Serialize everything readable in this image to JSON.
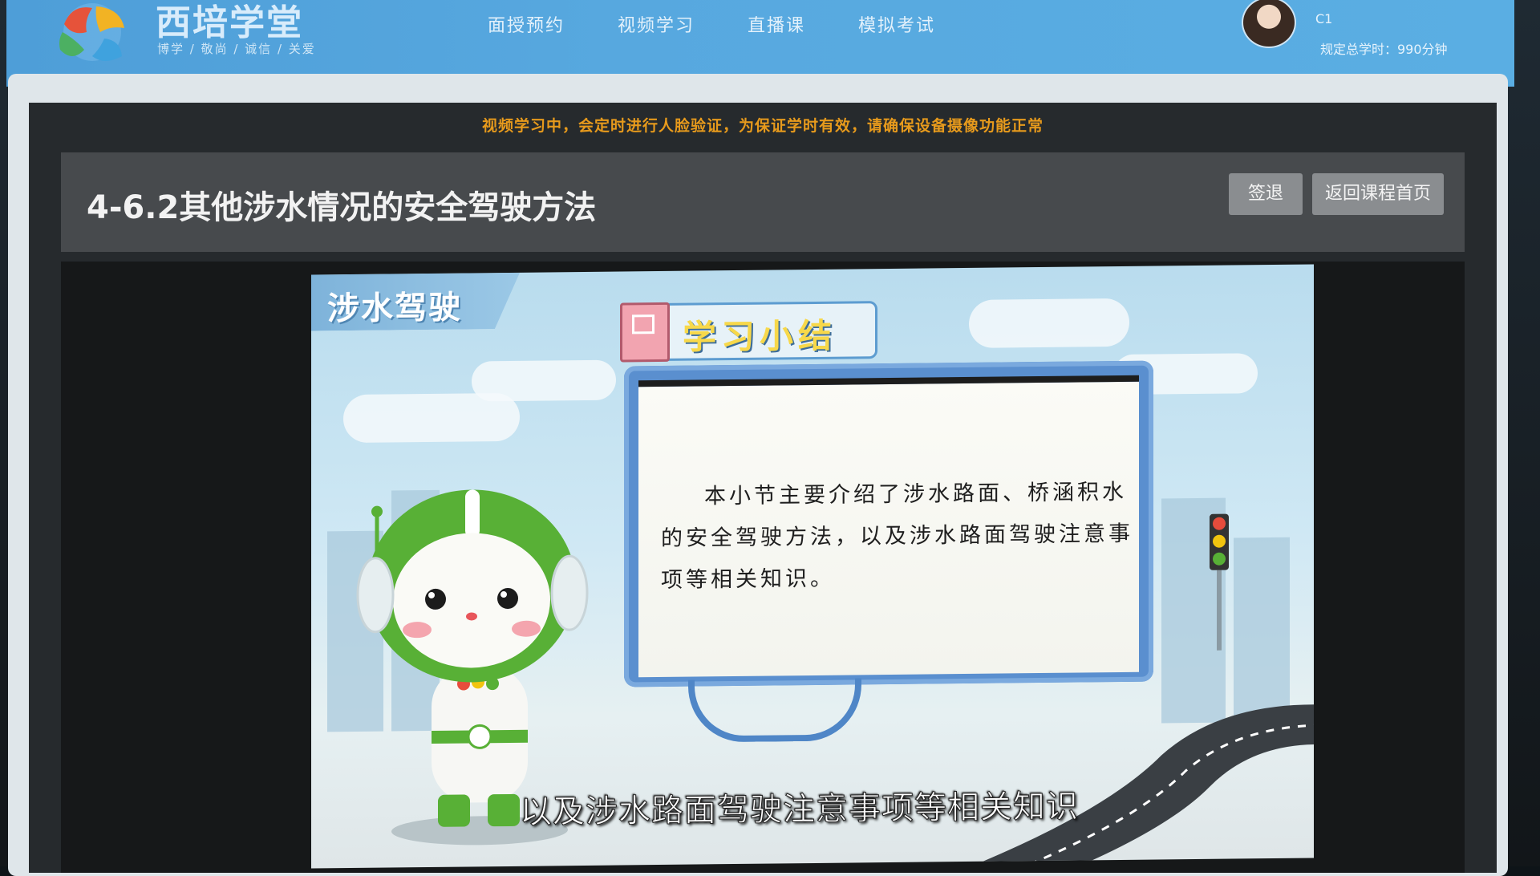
{
  "header": {
    "site_name": "西培学堂",
    "slogan": "博学 / 敬尚 / 诚信 / 关爱",
    "nav": [
      "面授预约",
      "视频学习",
      "直播课",
      "模拟考试"
    ],
    "license_type": "C1",
    "required_time": "规定总学时：990分钟"
  },
  "player": {
    "notice": "视频学习中，会定时进行人脸验证，为保证学时有效，请确保设备摄像功能正常",
    "lesson_title": "4-6.2其他涉水情况的安全驾驶方法",
    "signout_label": "签退",
    "return_label": "返回课程首页"
  },
  "video": {
    "tag": "涉水驾驶",
    "banner": "学习小结",
    "board_text": "本小节主要介绍了涉水路面、桥涵积水的安全驾驶方法，以及涉水路面驾驶注意事项等相关知识。",
    "subtitle": "以及涉水路面驾驶注意事项等相关知识"
  },
  "colors": {
    "header_blue": "#57a8df",
    "notice_orange": "#e79a1c",
    "button_gray": "#8a8d90",
    "panel_dark": "#262a2d",
    "mascot_green": "#58b036"
  },
  "icons": [
    "logo-icon",
    "avatar",
    "book-icon",
    "traffic-light-icon"
  ]
}
